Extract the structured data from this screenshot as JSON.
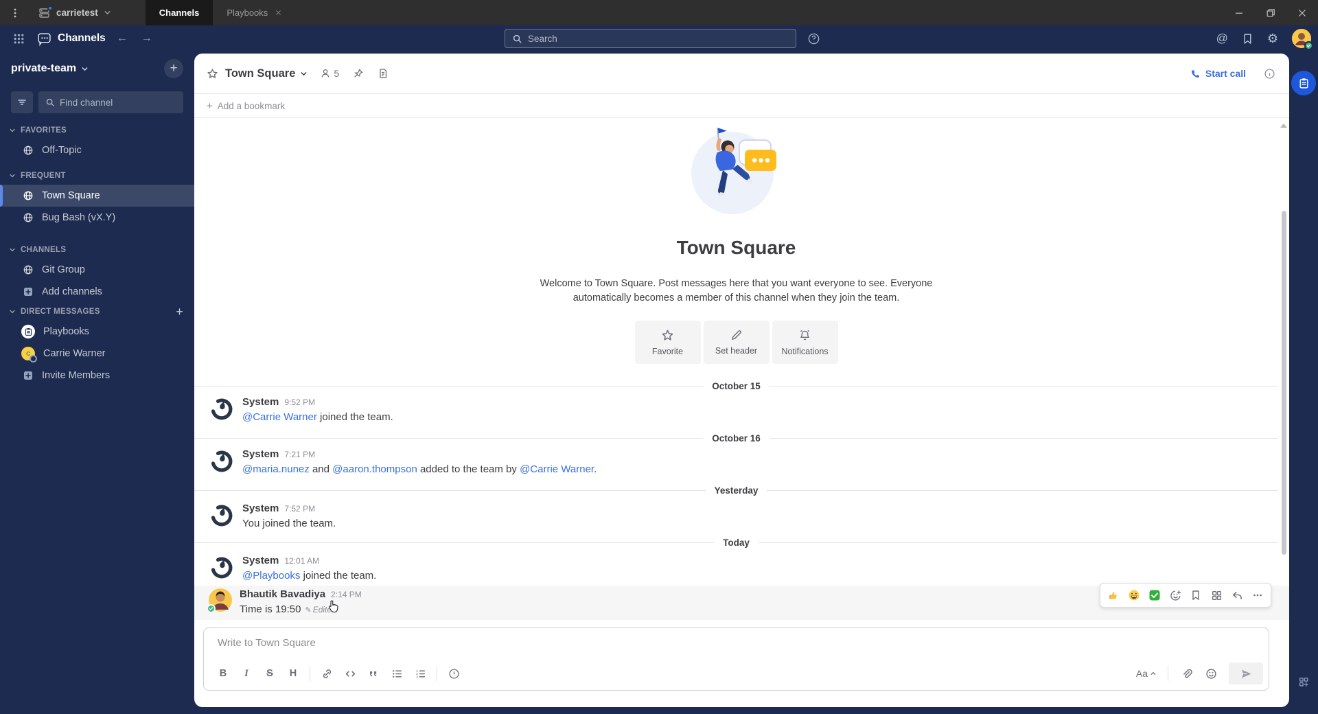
{
  "titlebar": {
    "server_name": "carrietest",
    "tab_channels": "Channels",
    "tab_playbooks": "Playbooks"
  },
  "header": {
    "product": "Channels",
    "search_placeholder": "Search",
    "at_glyph": "@",
    "gear_glyph": "⚙",
    "back_glyph": "←",
    "forward_glyph": "→"
  },
  "sidebar": {
    "team_name": "private-team",
    "find_placeholder": "Find channel",
    "add_glyph": "+",
    "sections": [
      {
        "label": "FAVORITES",
        "items": [
          {
            "label": "Off-Topic",
            "icon": "globe-icon"
          }
        ]
      },
      {
        "label": "FREQUENT",
        "items": [
          {
            "label": "Town Square",
            "icon": "globe-icon",
            "selected": true
          },
          {
            "label": "Bug Bash (vX.Y)",
            "icon": "globe-icon"
          }
        ]
      },
      {
        "label": "CHANNELS",
        "items": [
          {
            "label": "Git Group",
            "icon": "globe-icon"
          },
          {
            "label": "Add channels",
            "icon": "plus-square-icon"
          }
        ]
      },
      {
        "label": "DIRECT MESSAGES",
        "items": [
          {
            "label": "Playbooks",
            "icon": "playbooks-avatar"
          },
          {
            "label": "Carrie Warner",
            "icon": "user-avatar"
          },
          {
            "label": "Invite Members",
            "icon": "plus-square-icon"
          }
        ]
      }
    ]
  },
  "channel": {
    "title": "Town Square",
    "member_count": "5",
    "start_call_label": "Start call"
  },
  "bookmark_bar": {
    "label": "Add a bookmark",
    "plus_glyph": "+"
  },
  "intro": {
    "title": "Town Square",
    "description_line1": "Welcome to Town Square. Post messages here that you want everyone to see. Everyone",
    "description_line2": "automatically becomes a member of this channel when they join the team.",
    "actions": [
      {
        "label": "Favorite",
        "icon": "star-icon"
      },
      {
        "label": "Set header",
        "icon": "pencil-icon"
      },
      {
        "label": "Notifications",
        "icon": "bell-icon"
      }
    ]
  },
  "feed": {
    "divider1": "October 15",
    "divider2": "October 16",
    "divider3": "Yesterday",
    "divider4": "Today",
    "m1": {
      "author": "System",
      "time": "9:52 PM",
      "link1": "@Carrie Warner",
      "text1": " joined the team."
    },
    "m2": {
      "author": "System",
      "time": "7:21 PM",
      "link1": "@maria.nunez",
      "text1": " and ",
      "link2": "@aaron.thompson",
      "text2": " added to the team by ",
      "link3": "@Carrie Warner",
      "text3": "."
    },
    "m3": {
      "author": "System",
      "time": "7:52 PM",
      "text1": "You joined the team."
    },
    "m4": {
      "author": "System",
      "time": "12:01 AM",
      "link1": "@Playbooks",
      "text1": " joined the team."
    },
    "m5": {
      "author": "Bhautik Bavadiya",
      "time": "2:14 PM",
      "text1": "Time is 19:50",
      "edited_label": "Edited",
      "edit_glyph": "✎"
    },
    "hover_quick_reactions": [
      "thumbs-up",
      "grinning-face",
      "white-check-mark"
    ]
  },
  "composer": {
    "placeholder": "Write to Town Square",
    "bold_glyph": "B",
    "italic_glyph": "I",
    "strike_glyph": "S",
    "heading_glyph": "H",
    "text_size_label": "Aa"
  },
  "colors": {
    "navy": "#1c2b4f",
    "blue": "#1c58d9",
    "link": "#386fe5",
    "selected_indicator": "#5d89ea",
    "bubble_yellow": "#ffbc1f"
  }
}
